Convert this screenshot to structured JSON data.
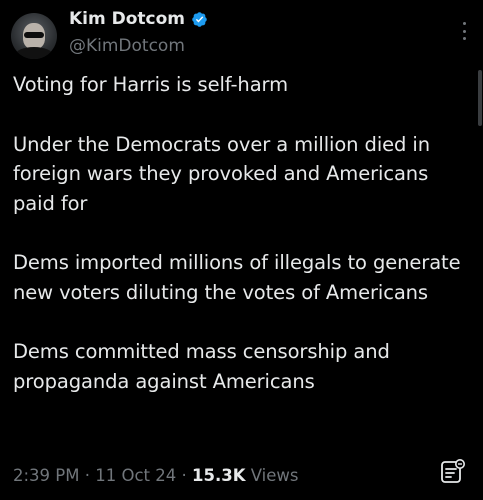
{
  "author": {
    "display_name": "Kim Dotcom",
    "handle": "@KimDotcom",
    "verified": true
  },
  "post": {
    "paragraphs": [
      "Voting for Harris is self-harm",
      "Under the Democrats over a million died in foreign wars they provoked and Americans paid for",
      "Dems imported millions of illegals to generate new voters diluting the votes of Americans",
      "Dems committed mass censorship and propaganda against Americans"
    ]
  },
  "meta": {
    "time": "2:39 PM",
    "sep1": " · ",
    "date": "11 Oct 24",
    "sep2": " · ",
    "views_count": "15.3K",
    "views_label": " Views"
  },
  "colors": {
    "background": "#000000",
    "text": "#e7e9ea",
    "secondary": "#71767b",
    "verified": "#1d9bf0"
  },
  "icons": {
    "verified": "verified-badge-icon",
    "more": "more-options-icon",
    "analytics": "post-analytics-icon"
  }
}
